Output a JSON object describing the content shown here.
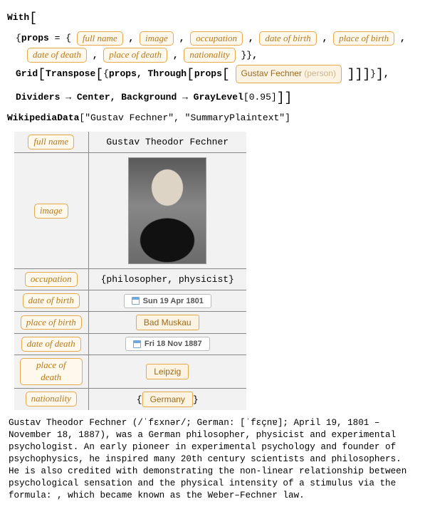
{
  "code": {
    "with": "With",
    "propsVar": "props",
    "eq": " = ",
    "props": [
      "full name",
      "image",
      "occupation",
      "date of birth",
      "place of birth",
      "date of death",
      "place of death",
      "nationality"
    ],
    "gridFn": "Grid",
    "transposeFn": "Transpose",
    "throughFn": "Through",
    "entityName": "Gustav Fechner",
    "entityType": "(person)",
    "optDividers": "Dividers",
    "arrow": " → ",
    "center": "Center",
    "optBackground": "Background",
    "grayLevel": "GrayLevel",
    "grayVal": "0.95",
    "wikiFn": "WikipediaData",
    "wikiArg1": "\"Gustav Fechner\"",
    "wikiArg2": "\"SummaryPlaintext\""
  },
  "grid": {
    "rows": [
      {
        "label": "full name",
        "kind": "text",
        "value": "Gustav Theodor Fechner"
      },
      {
        "label": "image",
        "kind": "image",
        "value": ""
      },
      {
        "label": "occupation",
        "kind": "list",
        "value": "{philosopher, physicist}"
      },
      {
        "label": "date of birth",
        "kind": "date",
        "value": "Sun 19 Apr 1801"
      },
      {
        "label": "place of birth",
        "kind": "place",
        "value": "Bad Muskau"
      },
      {
        "label": "date of death",
        "kind": "date",
        "value": "Fri 18 Nov 1887"
      },
      {
        "label": "place of death",
        "kind": "place",
        "value": "Leipzig"
      },
      {
        "label": "nationality",
        "kind": "placelist",
        "value": "Germany"
      }
    ]
  },
  "summary": "Gustav Theodor Fechner (/ˈfɛxnər/; German: [ˈfɛçnɐ]; April 19, 1801 – November 18, 1887), was a German philosopher, physicist and experimental psychologist. An early pioneer in experimental psychology and founder of psychophysics, he inspired many 20th century scientists and philosophers. He is also credited with demonstrating the non-linear relationship between psychological sensation and the physical intensity of a stimulus via the formula: , which became known as the Weber–Fechner law."
}
